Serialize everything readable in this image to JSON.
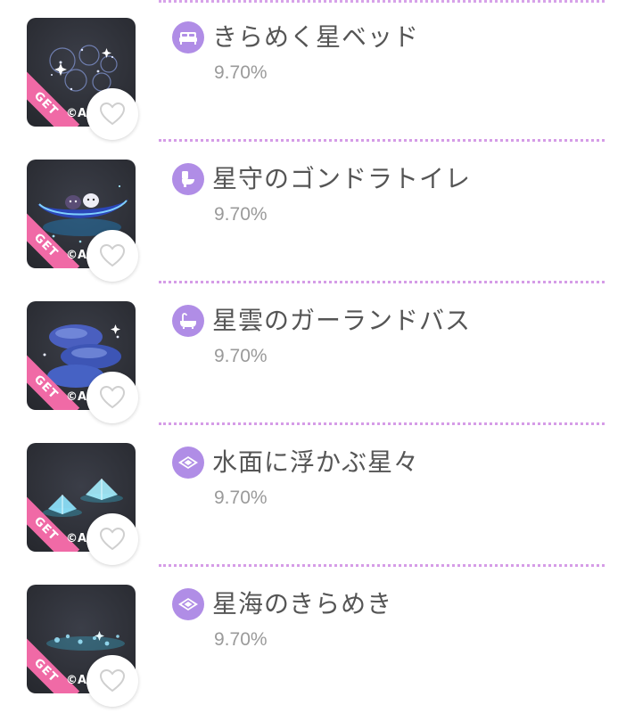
{
  "items": [
    {
      "name": "きらめく星ベッド",
      "rate": "9.70%",
      "category_icon": "bed-icon",
      "ribbon": "GET",
      "copyright": "©A/"
    },
    {
      "name": "星守のゴンドラトイレ",
      "rate": "9.70%",
      "category_icon": "toilet-icon",
      "ribbon": "GET",
      "copyright": "©A/"
    },
    {
      "name": "星雲のガーランドバス",
      "rate": "9.70%",
      "category_icon": "bathtub-icon",
      "ribbon": "GET",
      "copyright": "©A/"
    },
    {
      "name": "水面に浮かぶ星々",
      "rate": "9.70%",
      "category_icon": "floor-tile-icon",
      "ribbon": "GET",
      "copyright": "©A/"
    },
    {
      "name": "星海のきらめき",
      "rate": "9.70%",
      "category_icon": "floor-tile-icon",
      "ribbon": "GET",
      "copyright": "©A/"
    }
  ],
  "colors": {
    "accent_purple": "#b08de6",
    "dotted_separator": "#c77be0",
    "ribbon_pink": "#f06aa6",
    "name_text": "#555555",
    "rate_text": "#9a9a9a"
  }
}
